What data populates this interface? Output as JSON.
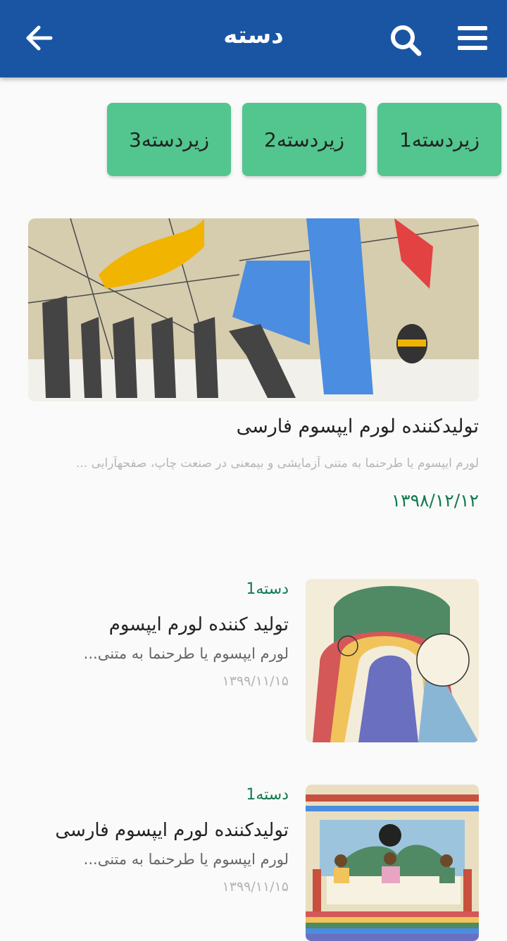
{
  "header": {
    "title": "دسته",
    "back_icon": "arrow-left-icon",
    "search_icon": "search-icon",
    "menu_icon": "hamburger-menu-icon",
    "color": "#1a55a3"
  },
  "subcategories": [
    {
      "label": "زیردسته1"
    },
    {
      "label": "زیردسته2"
    },
    {
      "label": "زیردسته3"
    }
  ],
  "featured": {
    "title": "تولیدکننده لورم ایپسوم فارسی",
    "description": "لورم ایپسوم یا طرحنما به متنی آزمایشی و بیمعنی در صنعت چاپ، صفحهآرایی ...",
    "date": "۱۳۹۸/۱۲/۱۲"
  },
  "articles": [
    {
      "category": "دسته1",
      "title": "تولید کننده لورم ایپسوم",
      "description": "لورم ایپسوم یا طرحنما به متنی...",
      "date": "۱۳۹۹/۱۱/۱۵"
    },
    {
      "category": "دسته1",
      "title": "تولیدکننده لورم ایپسوم فارسی",
      "description": "لورم ایپسوم یا طرحنما به متنی...",
      "date": "۱۳۹۹/۱۱/۱۵"
    }
  ],
  "colors": {
    "accent_green": "#52c68e",
    "date_green": "#127a4f"
  }
}
